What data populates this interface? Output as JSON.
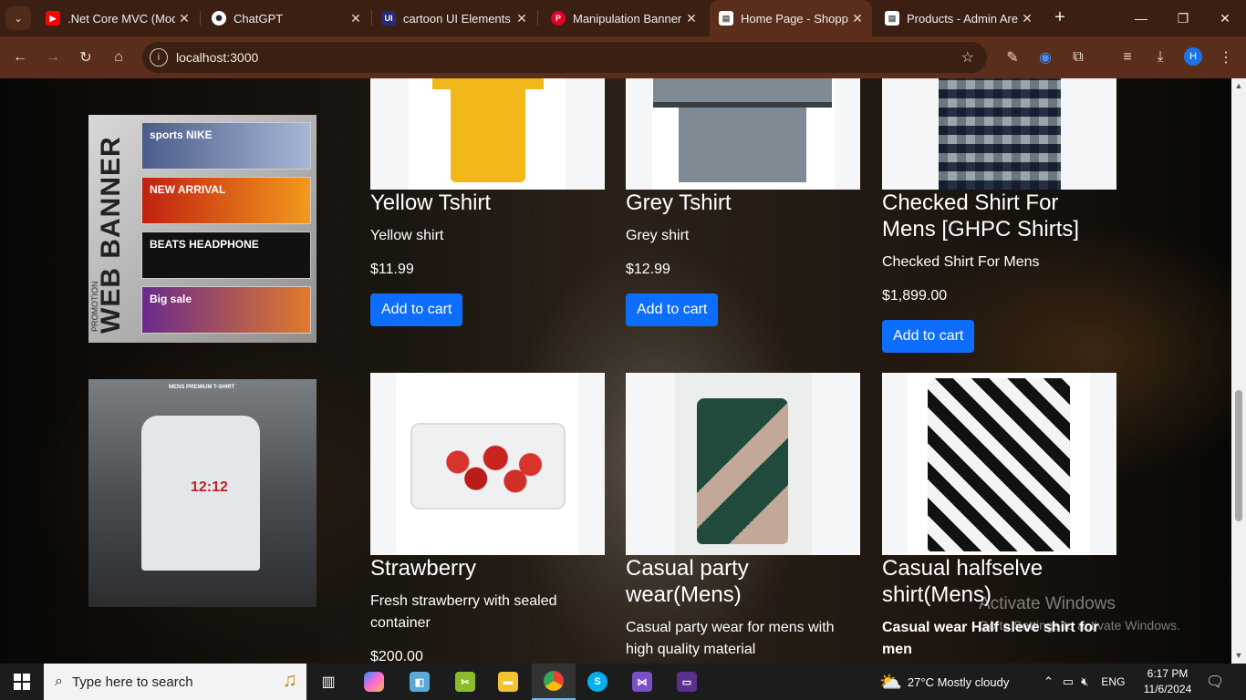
{
  "browser": {
    "tabs": [
      {
        "title": ".Net Core MVC (Mode",
        "icon": "youtube-icon",
        "color": "#ff0000",
        "active": false
      },
      {
        "title": "ChatGPT",
        "icon": "chatgpt-icon",
        "color": "#ffffff",
        "active": false
      },
      {
        "title": "cartoon UI Elements i",
        "icon": "ui-icon",
        "color": "#3b3bd6",
        "active": false
      },
      {
        "title": "Manipulation Banner",
        "icon": "pinterest-icon",
        "color": "#e60023",
        "active": false
      },
      {
        "title": "Home Page - Shoppin",
        "icon": "page-icon",
        "color": "#ffffff",
        "active": true
      },
      {
        "title": "Products - Admin Are",
        "icon": "page-icon",
        "color": "#ffffff",
        "active": false
      }
    ],
    "url": "localhost:3000",
    "profile_initial": "H"
  },
  "page": {
    "banners": [
      {
        "title": "WEB BANNER",
        "subtitle": "PROMOTION",
        "cards": [
          "sports NIKE",
          "NEW ARRIVAL",
          "BEATS HEADPHONE",
          "Big sale"
        ]
      },
      {
        "title": "MENS PREMIUM T-SHIRT",
        "shirt_text": "12:12"
      }
    ],
    "products": [
      {
        "title": "Yellow Tshirt",
        "description": "Yellow shirt",
        "price": "$11.99",
        "button": "Add to cart"
      },
      {
        "title": "Grey Tshirt",
        "description": "Grey shirt",
        "price": "$12.99",
        "button": "Add to cart"
      },
      {
        "title": "Checked Shirt For Mens [GHPC Shirts]",
        "description": " Checked Shirt For Mens",
        "price": "$1,899.00",
        "button": "Add to cart"
      },
      {
        "title": "Strawberry",
        "description": "Fresh strawberry with sealed container",
        "price": "$200.00"
      },
      {
        "title": "Casual party wear(Mens)",
        "description": "Casual party wear for mens with high quality material"
      },
      {
        "title": "Casual halfselve shirt(Mens)",
        "description": "Casual wear Half sleve shirt for men"
      }
    ],
    "watermark": {
      "line1": "Activate Windows",
      "line2": "Go to Settings to activate Windows."
    }
  },
  "taskbar": {
    "search_placeholder": "Type here to search",
    "weather": "27°C  Mostly cloudy",
    "language": "ENG",
    "time": "6:17 PM",
    "date": "11/6/2024"
  }
}
